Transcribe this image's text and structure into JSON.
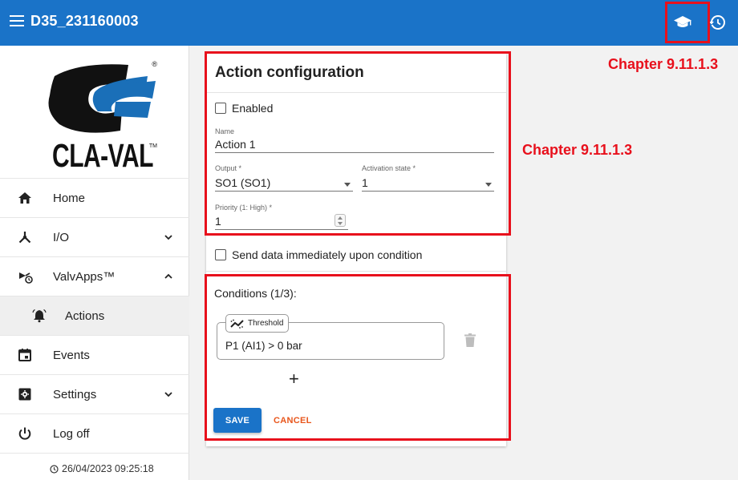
{
  "header": {
    "device_title": "D35_231160003",
    "help_icon": "graduation-cap-icon",
    "history_icon": "history-icon"
  },
  "sidebar": {
    "logo_text": "CLA-VAL",
    "logo_registered": "®",
    "logo_trademark": "TM",
    "items": [
      {
        "label": "Home",
        "icon": "home-icon"
      },
      {
        "label": "I/O",
        "icon": "io-icon",
        "expandable": true,
        "expanded": false
      },
      {
        "label": "ValvApps™",
        "icon": "valvapps-icon",
        "expandable": true,
        "expanded": true
      },
      {
        "label": "Actions",
        "icon": "bell-icon",
        "sub": true,
        "active": true
      },
      {
        "label": "Events",
        "icon": "calendar-icon"
      },
      {
        "label": "Settings",
        "icon": "settings-icon",
        "expandable": true,
        "expanded": false
      },
      {
        "label": "Log off",
        "icon": "power-icon"
      }
    ],
    "timestamp": "26/04/2023 09:25:18"
  },
  "form": {
    "title": "Action configuration",
    "enabled_label": "Enabled",
    "enabled_checked": false,
    "name_label": "Name",
    "name_value": "Action 1",
    "output_label": "Output *",
    "output_value": "SO1 (SO1)",
    "activation_label": "Activation state *",
    "activation_value": "1",
    "priority_label": "Priority (1: High) *",
    "priority_value": "1",
    "send_data_label": "Send data immediately upon condition",
    "send_data_checked": false,
    "conditions_title": "Conditions (1/3):",
    "condition_chip": "Threshold",
    "condition_text": "P1 (AI1) > 0 bar",
    "add_symbol": "+",
    "save_label": "SAVE",
    "cancel_label": "CANCEL"
  },
  "annotations": {
    "chapter_top": "Chapter 9.11.1.3",
    "chapter_mid": "Chapter 9.11.1.3",
    "color": "#e8101c"
  },
  "colors": {
    "primary": "#1a73c8",
    "cancel": "#e8561c"
  }
}
